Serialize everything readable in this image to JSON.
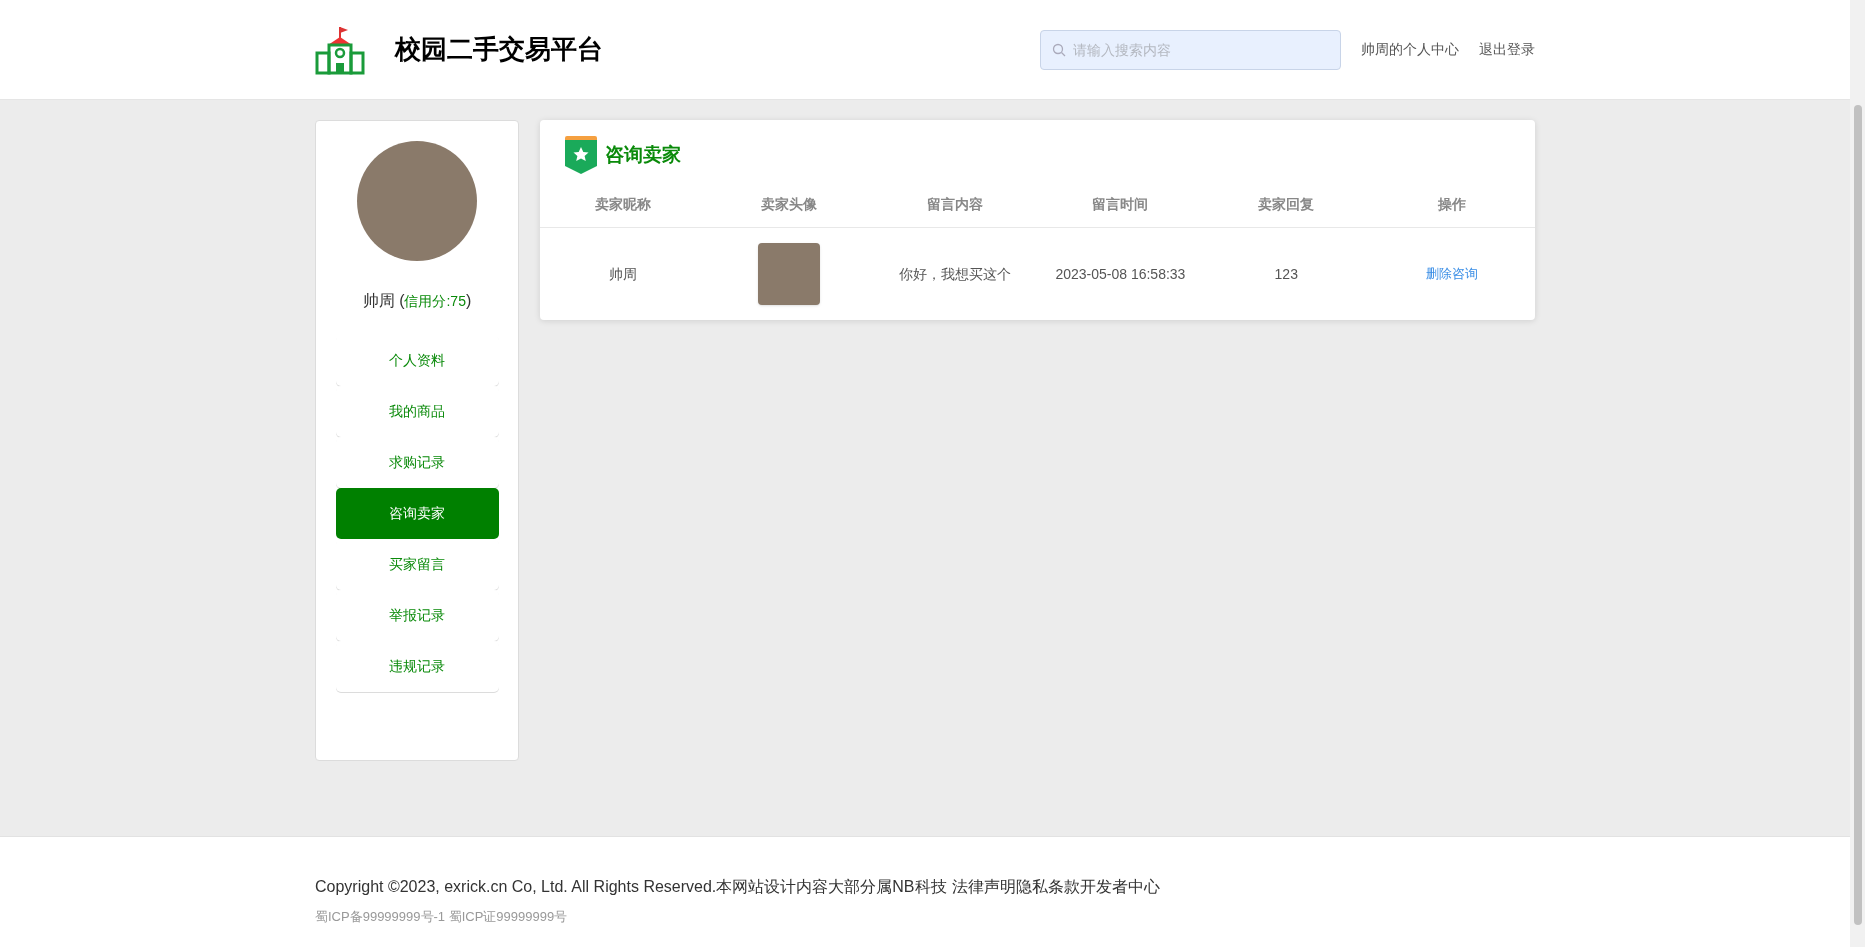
{
  "header": {
    "site_title": "校园二手交易平台",
    "search": {
      "placeholder": "请输入搜索内容"
    },
    "nav_links": [
      "帅周的个人中心",
      "退出登录"
    ]
  },
  "profile": {
    "name": "帅周",
    "brackets": [
      "(",
      ")"
    ],
    "credit_label": "信用分:75"
  },
  "sidebar": {
    "items": [
      {
        "label": "个人资料",
        "selected": false
      },
      {
        "label": "我的商品",
        "selected": false
      },
      {
        "label": "求购记录",
        "selected": false
      },
      {
        "label": "咨询卖家",
        "selected": true
      },
      {
        "label": "买家留言",
        "selected": false
      },
      {
        "label": "举报记录",
        "selected": false
      },
      {
        "label": "违规记录",
        "selected": false
      }
    ]
  },
  "panel": {
    "title": "咨询卖家",
    "table": {
      "columns": [
        "卖家昵称",
        "卖家头像",
        "留言内容",
        "留言时间",
        "卖家回复",
        "操作"
      ],
      "rows": [
        {
          "seller_name": "帅周",
          "message": "你好，我想买这个",
          "time": "2023-05-08 16:58:33",
          "reply": "123",
          "action": "删除咨询"
        }
      ]
    }
  },
  "footer": {
    "copyright": "Copyright ©2023, exrick.cn Co, Ltd. All Rights Reserved.本网站设计内容大部分属NB科技",
    "links": [
      "法律声明",
      "隐私条款",
      "开发者中心"
    ],
    "icp": "蜀ICP备99999999号-1 蜀ICP证99999999号"
  }
}
